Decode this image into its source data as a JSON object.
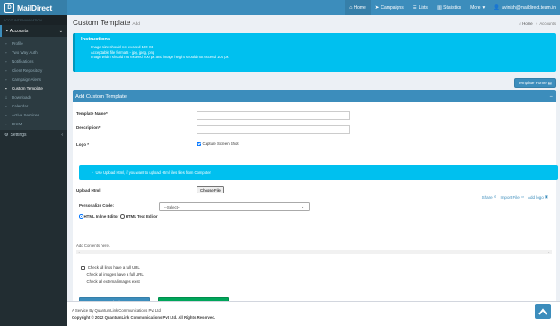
{
  "brand": {
    "logo_letter": "D",
    "name": "MailDirect"
  },
  "nav": {
    "home": "Home",
    "campaigns": "Campaigns",
    "lists": "Lists",
    "statistics": "Statistics",
    "more": "More",
    "user": "avinish@maildirect.team.in"
  },
  "sidebar": {
    "header": "ACCOUNTS NAVIGATION",
    "section": "Accounts",
    "items": [
      {
        "label": "Profile"
      },
      {
        "label": "Two Way Auth"
      },
      {
        "label": "Notifications"
      },
      {
        "label": "Client Repository"
      },
      {
        "label": "Campaign Alerts"
      },
      {
        "label": "Custom Template"
      },
      {
        "label": "Downloads"
      },
      {
        "label": "Calendar"
      },
      {
        "label": "Active Services"
      },
      {
        "label": "DKIM"
      }
    ],
    "settings": "Settings"
  },
  "page": {
    "title": "Custom Template",
    "subtitle": "Add",
    "breadcrumb_home": "Home",
    "breadcrumb_current": "Accounts"
  },
  "instructions": {
    "title": "Instructions",
    "items": [
      "Image size should not exceed 100 KB",
      "Acceptable file formats - jpg, jpeg, png",
      "Image width should not exceed 200 px and image height should not exceed 100 px"
    ]
  },
  "template_home_button": "Template Home",
  "form": {
    "header": "Add Custom Template",
    "template_name_label": "Template Name",
    "description_label": "Description",
    "logo_label": "Logo",
    "capture_screenshot_label": "Capture Screen Shot",
    "upload_info": "Use Upload Html, if you want to upload Html files files from Computer",
    "upload_html_label": "Upload Html",
    "choose_file": "Choose File",
    "share": "Share",
    "import_file": "Import File",
    "add_logo": "Add logo",
    "personalize_label": "Personalize Code:",
    "personalize_value": "--Select--",
    "html_inline_editor": "HTML Inline Editor",
    "html_text_editor": "HTML Text Editor",
    "add_contents": "Add Contents here .",
    "check_links": "Check all links have a full URL",
    "check_images": "Check all images have a full URL",
    "check_external": "Check all external images exist",
    "submit": "Submit",
    "reset": "Reset"
  },
  "footer": {
    "service": "A Service By QuantumLink Communications Pvt Ltd",
    "copyright": "Copyright © 2022 QuantumLink Communications Pvt Ltd. All Rights Reserved.",
    "version": "V"
  }
}
